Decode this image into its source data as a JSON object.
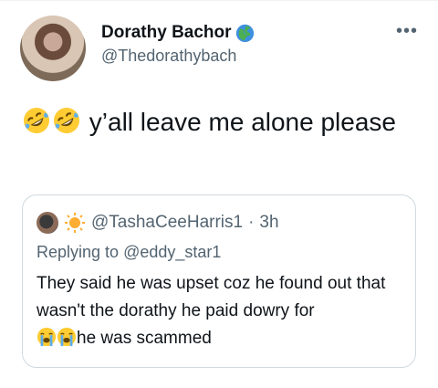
{
  "tweet": {
    "author": {
      "display_name": "Dorathy Bachor",
      "handle": "@Thedorathybach",
      "name_badge": "globe-icon"
    },
    "more_icon": "more-icon",
    "more_label": "•••",
    "body": {
      "emojis": [
        "rolling-on-floor-laughing-emoji",
        "rolling-on-floor-laughing-emoji"
      ],
      "text": "y’all leave me alone please"
    },
    "quote": {
      "handle": "@TashaCeeHarris1",
      "separator": "·",
      "time": "3h",
      "replying_prefix": "Replying to",
      "replying_to": "@eddy_star1",
      "text_line": "They said he was upset coz he found out that wasn't the dorathy he paid dowry for",
      "text_tail": "he was scammed",
      "emojis": [
        "loudly-crying-emoji",
        "loudly-crying-emoji"
      ]
    }
  }
}
